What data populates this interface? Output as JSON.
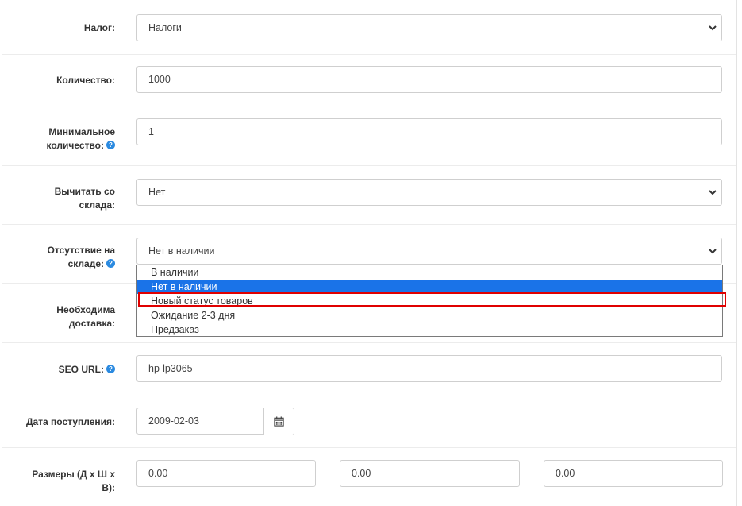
{
  "fields": {
    "tax": {
      "label": "Налог:",
      "value": "Налоги"
    },
    "quantity": {
      "label": "Количество:",
      "value": "1000"
    },
    "min_quantity": {
      "label_line1": "Минимальное",
      "label_line2": "количество:",
      "value": "1"
    },
    "subtract": {
      "label_line1": "Вычитать со",
      "label_line2": "склада:",
      "value": "Нет"
    },
    "out_of_stock": {
      "label_line1": "Отсутствие на",
      "label_line2": "складе:",
      "value": "Нет в наличии"
    },
    "shipping": {
      "label_line1": "Необходима",
      "label_line2": "доставка:"
    },
    "seo": {
      "label": "SEO URL:",
      "value": "hp-lp3065"
    },
    "date": {
      "label": "Дата поступления:",
      "value": "2009-02-03"
    },
    "dimensions": {
      "label_line1": "Размеры (Д х Ш х",
      "label_line2": "В):",
      "length": "0.00",
      "width": "0.00",
      "height": "0.00"
    }
  },
  "help_glyph": "?",
  "dropdown": {
    "options": [
      "В наличии",
      "Нет в наличии",
      "Новый статус товаров",
      "Ожидание 2-3 дня",
      "Предзаказ"
    ],
    "selected_index": 1,
    "highlighted_index": 2
  },
  "colors": {
    "selected_option": "#1a73e8",
    "highlight_border": "#e00000",
    "help_icon": "#2b8ae0"
  },
  "icons": {
    "select_arrow": "chevron-down-icon",
    "calendar": "calendar-icon",
    "help": "help-icon"
  }
}
